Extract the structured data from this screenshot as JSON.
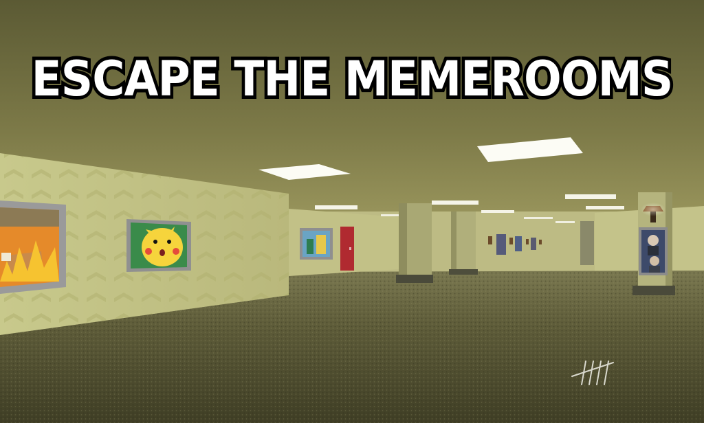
{
  "game": {
    "title": "ESCAPE THE MEMEROOMS",
    "tally_marks": 5
  },
  "scene": {
    "paintings": [
      {
        "name": "this-is-fine-meme-painting"
      },
      {
        "name": "surprised-pikachu-painting"
      },
      {
        "name": "cartoon-scene-painting"
      },
      {
        "name": "portrait-meme-painting"
      }
    ],
    "colors": {
      "ceiling": "#6e6b3e",
      "wall": "#c8c48a",
      "carpet": "#5e5c38",
      "door": "#b02a30",
      "light": "#fbfbf4"
    }
  }
}
